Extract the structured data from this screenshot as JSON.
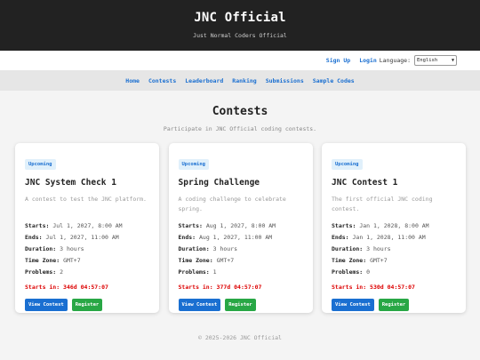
{
  "header": {
    "title": "JNC Official",
    "subtitle": "Just Normal Coders Official"
  },
  "auth": {
    "signup": "Sign Up",
    "login": "Login",
    "language_label": "Language:",
    "language_value": "English"
  },
  "nav": {
    "items": [
      "Home",
      "Contests",
      "Leaderboard",
      "Ranking",
      "Submissions",
      "Sample Codes"
    ]
  },
  "main": {
    "title": "Contests",
    "intro": "Participate in JNC Official coding contests."
  },
  "labels": {
    "starts": "Starts:",
    "ends": "Ends:",
    "duration": "Duration:",
    "timezone": "Time Zone:",
    "problems": "Problems:",
    "view": "View Contest",
    "register": "Register"
  },
  "contests": [
    {
      "badge": "Upcoming",
      "title": "JNC System Check 1",
      "desc": "A contest to test the JNC platform.",
      "starts": "Jul 1, 2027, 8:00 AM",
      "ends": "Jul 1, 2027, 11:00 AM",
      "duration": "3 hours",
      "timezone": "GMT+7",
      "problems": "2",
      "countdown": "Starts in: 346d 04:57:07"
    },
    {
      "badge": "Upcoming",
      "title": "Spring Challenge",
      "desc": "A coding challenge to celebrate spring.",
      "starts": "Aug 1, 2027, 8:00 AM",
      "ends": "Aug 1, 2027, 11:00 AM",
      "duration": "3 hours",
      "timezone": "GMT+7",
      "problems": "1",
      "countdown": "Starts in: 377d 04:57:07"
    },
    {
      "badge": "Upcoming",
      "title": "JNC Contest 1",
      "desc": "The first official JNC coding contest.",
      "starts": "Jan 1, 2028, 8:00 AM",
      "ends": "Jan 1, 2028, 11:00 AM",
      "duration": "3 hours",
      "timezone": "GMT+7",
      "problems": "0",
      "countdown": "Starts in: 530d 04:57:07"
    }
  ],
  "footer": {
    "text": "© 2025-2026 JNC Official"
  },
  "colors": {
    "header_bg": "#222222",
    "link": "#1a6fd1",
    "view_button": "#1a6fd1",
    "register_button": "#28a745",
    "countdown": "#dd0000",
    "badge_bg": "#e0f0fb"
  }
}
